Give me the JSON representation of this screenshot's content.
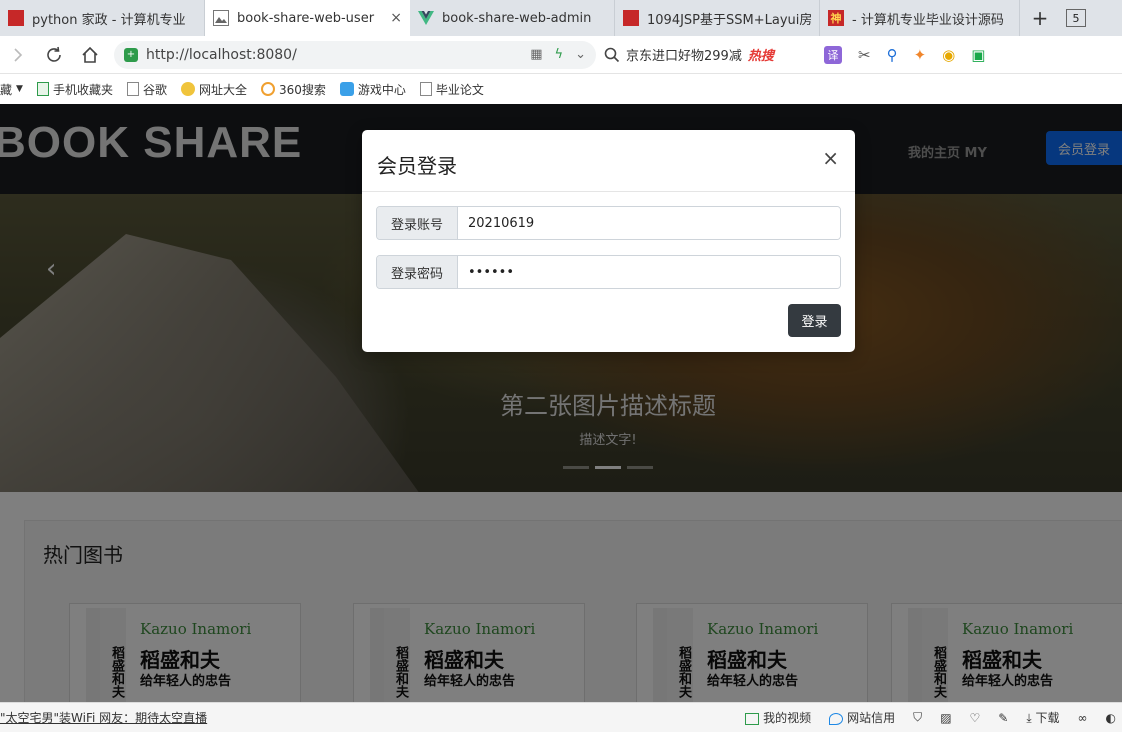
{
  "browser": {
    "tabs": [
      {
        "title": "python 家政 - 计算机专业",
        "favicon": "red-square-icon",
        "active": false
      },
      {
        "title": "book-share-web-user",
        "favicon": "image-icon",
        "active": true,
        "close": "×"
      },
      {
        "title": "book-share-web-admin",
        "favicon": "vue-logo-icon",
        "active": false
      },
      {
        "title": "1094JSP基于SSM+Layui房",
        "favicon": "red-square-icon",
        "active": false
      },
      {
        "title": "- 计算机专业毕业设计源码",
        "favicon": "shen-logo-icon",
        "favicon_text": "神",
        "active": false
      }
    ],
    "new_tab": "+",
    "tab_count": "5",
    "address": {
      "url": "http://localhost:8080/"
    },
    "search": {
      "text": "京东进口好物299减",
      "badge": "热搜"
    },
    "translate_label": "译",
    "bookmarks": [
      {
        "label": "藏",
        "icon": "folder-icon"
      },
      {
        "label": "手机收藏夹",
        "icon": "phone-icon"
      },
      {
        "label": "谷歌",
        "icon": "page-icon"
      },
      {
        "label": "网址大全",
        "icon": "plus-circle-icon"
      },
      {
        "label": "360搜索",
        "icon": "ring-icon"
      },
      {
        "label": "游戏中心",
        "icon": "game-icon"
      },
      {
        "label": "毕业论文",
        "icon": "page-icon"
      }
    ]
  },
  "site": {
    "brand": "BOOK SHARE",
    "nav_my": "我的主页 MY",
    "nav_login": "会员登录",
    "carousel": {
      "prev": "‹",
      "title": "第二张图片描述标题",
      "desc": "描述文字!",
      "indicators": 3,
      "active_index": 1
    },
    "hot": {
      "title": "热门图书",
      "books": [
        {
          "author": "Kazuo Inamori",
          "name": "稻盛和夫",
          "subtitle": "给年轻人的忠告",
          "spine": "稻盛和夫"
        },
        {
          "author": "Kazuo Inamori",
          "name": "稻盛和夫",
          "subtitle": "给年轻人的忠告",
          "spine": "稻盛和夫"
        },
        {
          "author": "Kazuo Inamori",
          "name": "稻盛和夫",
          "subtitle": "给年轻人的忠告",
          "spine": "稻盛和夫"
        },
        {
          "author": "Kazuo Inamori",
          "name": "稻盛和夫",
          "subtitle": "给年轻人的忠告",
          "spine": "稻盛和夫"
        }
      ]
    }
  },
  "modal": {
    "title": "会员登录",
    "close": "×",
    "account_label": "登录账号",
    "account_value": "20210619",
    "password_label": "登录密码",
    "password_value": "••••••",
    "submit": "登录"
  },
  "statusbar": {
    "news": "\"太空宅男\"装WiFi 网友：期待太空直播",
    "items": [
      "我的视频",
      "网站信用",
      "下载"
    ]
  }
}
